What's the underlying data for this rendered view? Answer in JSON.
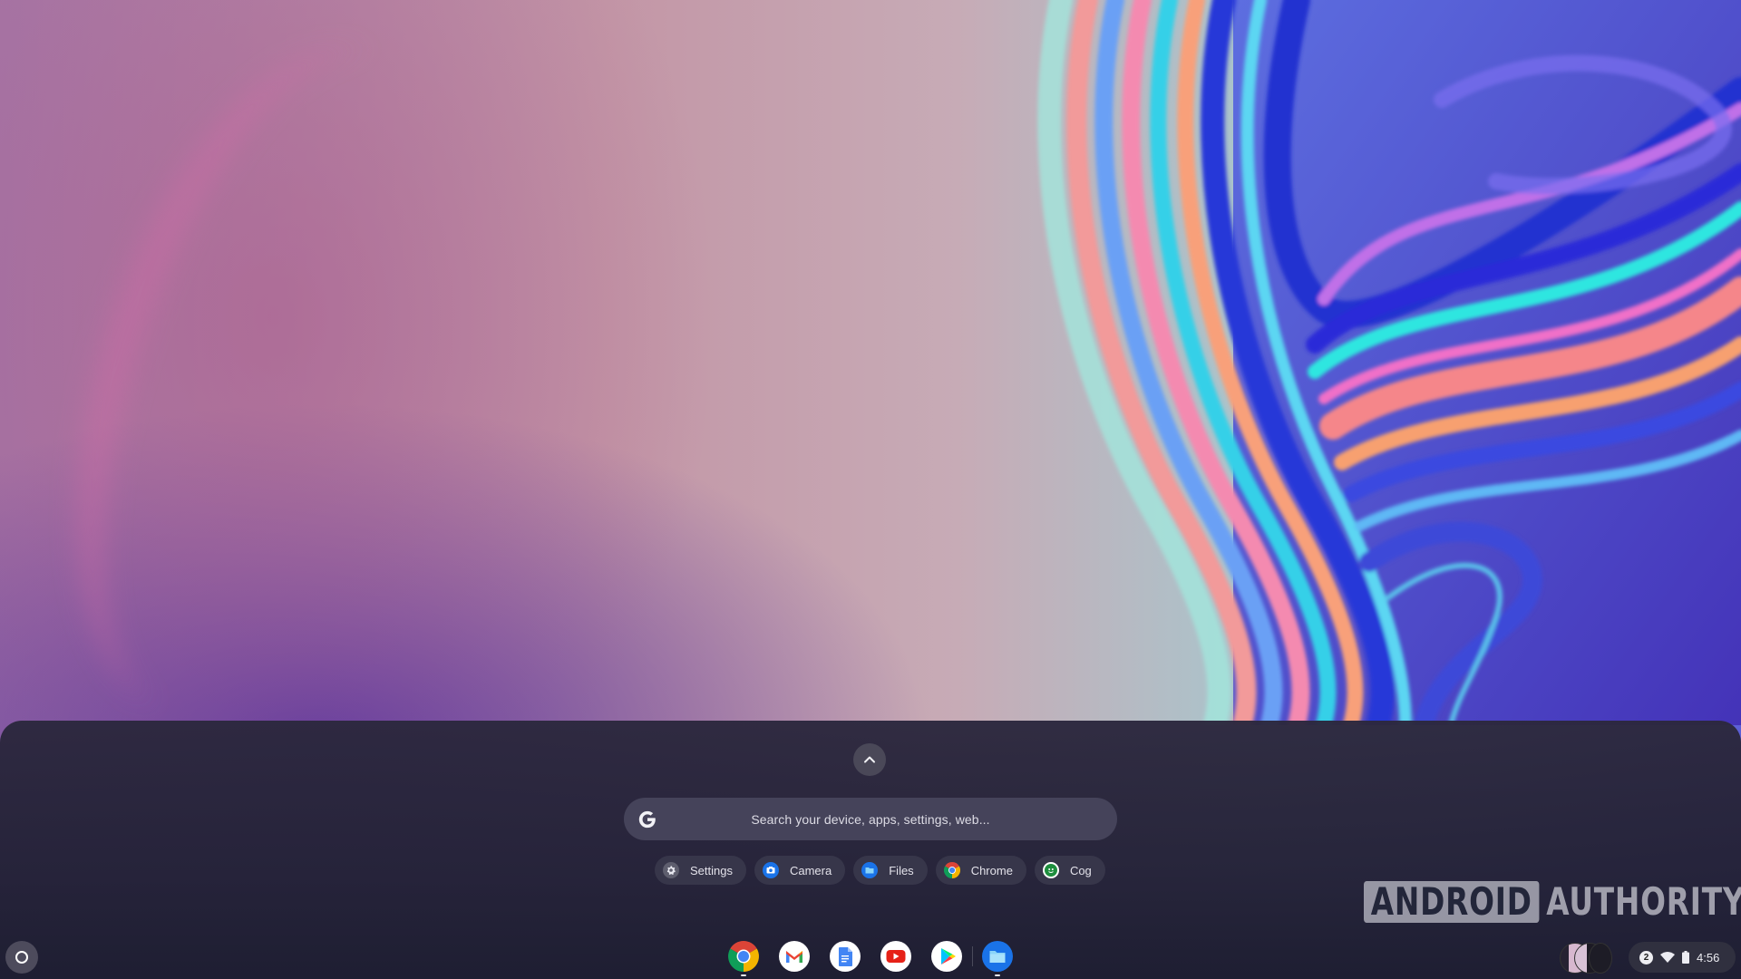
{
  "wallpaper": {
    "name": "colorful-swirl-wallpaper"
  },
  "launcher": {
    "expand_label": "Expand launcher",
    "search": {
      "placeholder": "Search your device, apps, settings, web..."
    },
    "suggestion_chips": [
      {
        "label": "Settings",
        "icon": "settings-gear-icon",
        "color": "#8a8a96"
      },
      {
        "label": "Camera",
        "icon": "camera-icon",
        "color": "#1a73e8"
      },
      {
        "label": "Files",
        "icon": "files-folder-icon",
        "color": "#1a73e8"
      },
      {
        "label": "Chrome",
        "icon": "chrome-icon",
        "color": "#4285f4"
      },
      {
        "label": "Cog",
        "icon": "cog-app-icon",
        "color": "#1e8e3e"
      }
    ]
  },
  "watermark": {
    "part1": "ANDROID",
    "part2": "AUTHORITY"
  },
  "shelf": {
    "apps": [
      {
        "name": "Chrome",
        "icon": "chrome-icon",
        "running": true
      },
      {
        "name": "Gmail",
        "icon": "gmail-icon",
        "running": false
      },
      {
        "name": "Docs",
        "icon": "docs-icon",
        "running": false
      },
      {
        "name": "YouTube",
        "icon": "youtube-icon",
        "running": false
      },
      {
        "name": "Play Store",
        "icon": "play-store-icon",
        "running": false
      },
      {
        "name": "Files",
        "icon": "files-icon",
        "running": true
      }
    ],
    "status_tray": {
      "notification_count": "2",
      "wifi": "connected",
      "battery": "charging",
      "time": "4:56"
    }
  }
}
